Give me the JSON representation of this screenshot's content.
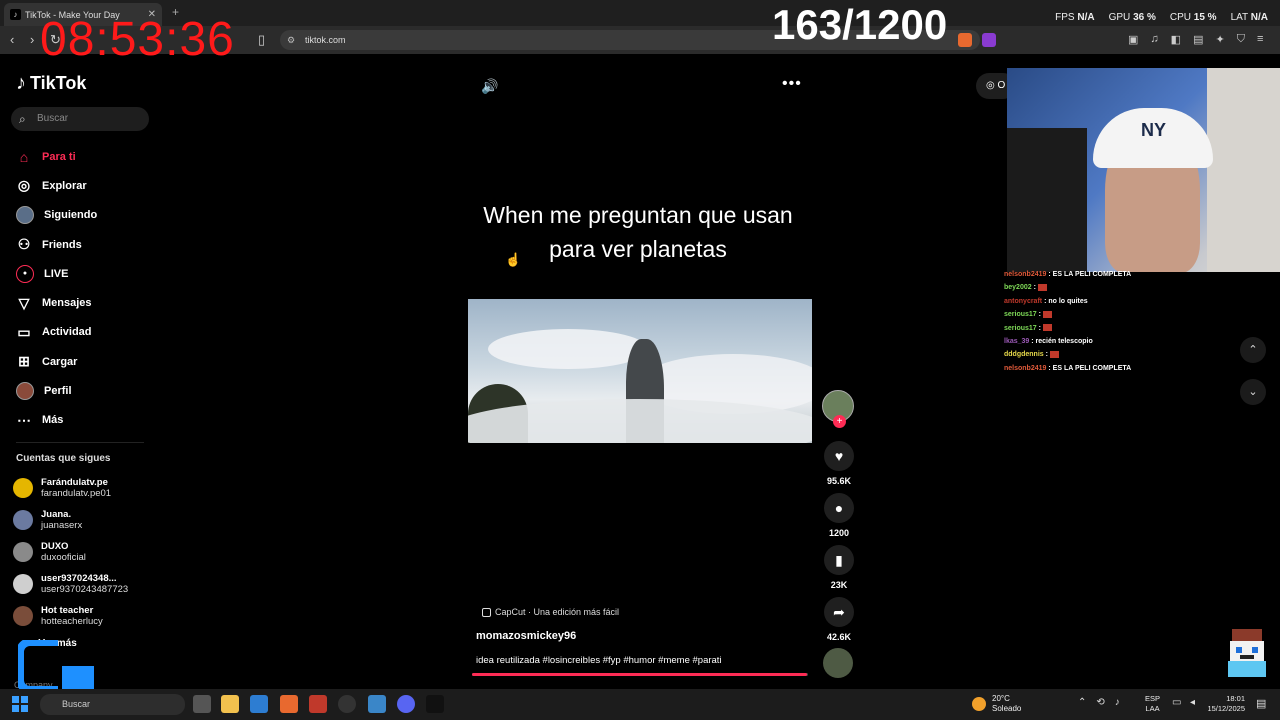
{
  "browser": {
    "tab_title": "TikTok - Make Your Day",
    "tab_close": "✕",
    "new_tab": "+",
    "url": "tiktok.com"
  },
  "overlay": {
    "clock": "08:53:36",
    "counter": "163/1200",
    "fps_label": "FPS",
    "fps_value": "N/A",
    "gpu_label": "GPU",
    "gpu_value": "36 %",
    "cpu_label": "CPU",
    "cpu_value": "15 %",
    "lat_label": "LAT",
    "lat_value": "N/A"
  },
  "sidebar": {
    "logo": "TikTok",
    "search_placeholder": "Buscar",
    "nav": [
      {
        "label": "Para ti",
        "icon": "home-icon"
      },
      {
        "label": "Explorar",
        "icon": "compass-icon"
      },
      {
        "label": "Siguiendo",
        "icon": "avatar-icon"
      },
      {
        "label": "Friends",
        "icon": "friends-icon"
      },
      {
        "label": "LIVE",
        "icon": "live-icon"
      },
      {
        "label": "Mensajes",
        "icon": "send-icon"
      },
      {
        "label": "Actividad",
        "icon": "activity-icon"
      },
      {
        "label": "Cargar",
        "icon": "upload-icon"
      },
      {
        "label": "Perfil",
        "icon": "profile-icon"
      },
      {
        "label": "Más",
        "icon": "more-icon"
      }
    ],
    "following_header": "Cuentas que sigues",
    "following": [
      {
        "name": "Farándulatv.pe",
        "handle": "farandulatv.pe01"
      },
      {
        "name": "Juana.",
        "handle": "juanaserx"
      },
      {
        "name": "DUXO",
        "handle": "duxooficial"
      },
      {
        "name": "user937024348...",
        "handle": "user9370243487723"
      },
      {
        "name": "Hot teacher",
        "handle": "hotteacherlucy"
      }
    ],
    "see_more": "Ver más",
    "company": "Company"
  },
  "video": {
    "caption": "When me preguntan que usan para ver planetas",
    "capcut_label": "CapCut · Una edición más fácil",
    "author": "momazosmickey96",
    "description": "idea reutilizada #losincreibles #fyp #humor #meme #parati",
    "progress": 0.997
  },
  "actions": {
    "likes": "95.6K",
    "comments": "1200",
    "saves": "23K",
    "shares": "42.6K"
  },
  "chat": [
    {
      "user": "nelsonb2419",
      "text": "ES LA PELI COMPLETA",
      "color": "#e05a3a"
    },
    {
      "user": "bey2002",
      "text": "",
      "color": "#7ed957",
      "emote": true
    },
    {
      "user": "antonycraft",
      "text": "no lo quites",
      "color": "#c0392b"
    },
    {
      "user": "serious17",
      "text": "",
      "color": "#7ed957",
      "emote": true
    },
    {
      "user": "serious17",
      "text": "",
      "color": "#7ed957",
      "emote": true
    },
    {
      "user": "lkas_39",
      "text": "recién telescopio",
      "color": "#9b59b6"
    },
    {
      "user": "dddgdennis",
      "text": "",
      "color": "#e6d84a",
      "emote": true
    },
    {
      "user": "nelsonb2419",
      "text": "ES LA PELI COMPLETA",
      "color": "#e05a3a"
    }
  ],
  "taskbar": {
    "search_placeholder": "Buscar",
    "weather_temp": "20°C",
    "weather_desc": "Soleado",
    "lang_1": "ESP",
    "lang_2": "LAA",
    "time": "18:01",
    "date": "15/12/2025"
  },
  "colors": {
    "accent": "#fe2c55",
    "clock": "#ff1a1a"
  }
}
